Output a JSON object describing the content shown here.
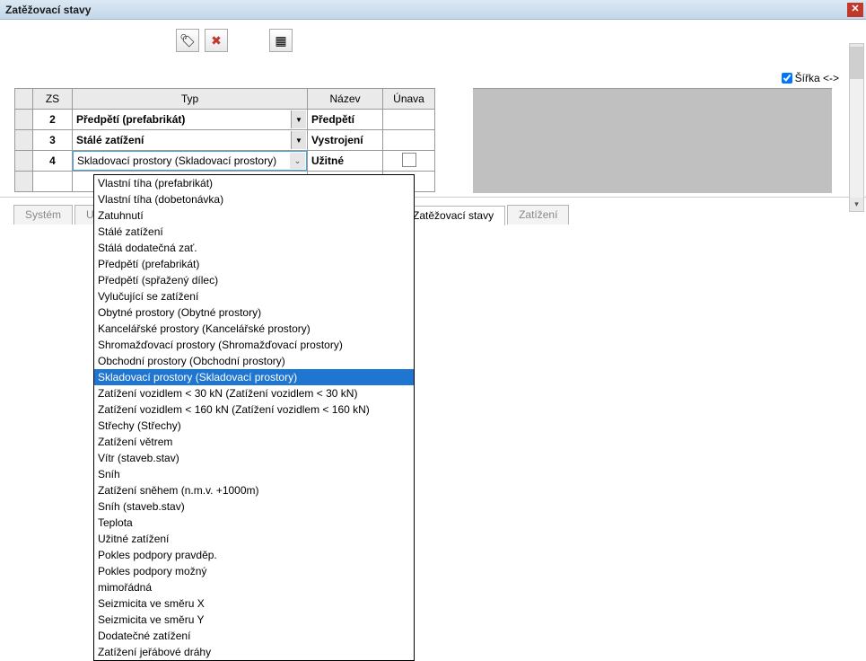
{
  "window": {
    "title": "Zatěžovací stavy"
  },
  "toolbar": {
    "btn1_glyph": "🏷",
    "btn2_glyph": "✖",
    "btn3_glyph": "▦"
  },
  "width_toggle": {
    "label": "Šířka <->",
    "checked": true
  },
  "columns": {
    "zs": "ZS",
    "typ": "Typ",
    "nazev": "Název",
    "unava": "Únava"
  },
  "rows": [
    {
      "zs": "2",
      "typ": "Předpětí (prefabrikát)",
      "nazev": "Předpětí",
      "unava": null,
      "active": false
    },
    {
      "zs": "3",
      "typ": "Stálé zatížení",
      "nazev": "Vystrojení",
      "unava": null,
      "active": false
    },
    {
      "zs": "4",
      "typ": "Skladovací prostory (Skladovací prostory)",
      "nazev": "Užitné",
      "unava": "checkbox",
      "active": true
    }
  ],
  "tabs": {
    "items": [
      {
        "label": "Systém",
        "active": false
      },
      {
        "label": "Ulož…",
        "active": false
      },
      {
        "label": "Zatěžovací stavy",
        "active": true
      },
      {
        "label": "Zatížení",
        "active": false
      }
    ]
  },
  "dropdown": {
    "selected_index": 11,
    "options": [
      "Vlastní tíha (prefabrikát)",
      "Vlastní tíha (dobetonávka)",
      "Zatuhnutí",
      "Stálé zatížení",
      "Stálá dodatečná zať.",
      "Předpětí (prefabrikát)",
      "Předpětí (spřažený dílec)",
      "Vylučující se zatížení",
      "Obytné prostory (Obytné prostory)",
      "Kancelářské prostory (Kancelářské prostory)",
      "Shromažďovací prostory (Shromažďovací prostory)",
      "Obchodní prostory (Obchodní prostory)",
      "Skladovací prostory (Skladovací prostory)",
      "Zatížení vozidlem < 30 kN (Zatížení vozidlem < 30 kN)",
      "Zatížení vozidlem < 160 kN (Zatížení vozidlem < 160 kN)",
      "Střechy (Střechy)",
      "Zatížení větrem",
      "Vítr (staveb.stav)",
      "Sníh",
      "Zatížení sněhem (n.m.v. +1000m)",
      "Sníh (staveb.stav)",
      "Teplota",
      "Užitné zatížení",
      "Pokles podpory pravděp.",
      "Pokles podpory možný",
      "mimořádná",
      "Seizmicita ve směru X",
      "Seizmicita ve směru Y",
      "Dodatečné zatížení",
      "Zatížení jeřábové dráhy"
    ]
  }
}
